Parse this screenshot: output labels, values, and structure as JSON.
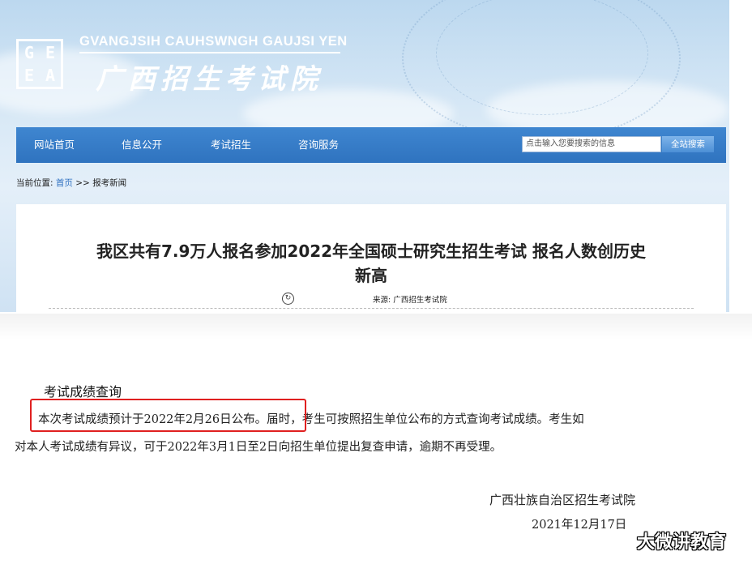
{
  "header": {
    "logo_letters": [
      "G",
      "E",
      "E",
      "A"
    ],
    "site_name_en": "GVANGJSIH CAUHSWNGH GAUJSI YEN",
    "site_name_cn": "广西招生考试院"
  },
  "nav": {
    "items": [
      {
        "label": "网站首页"
      },
      {
        "label": "信息公开"
      },
      {
        "label": "考试招生"
      },
      {
        "label": "咨询服务"
      }
    ],
    "search_placeholder": "点击输入您要搜索的信息",
    "search_button": "全站搜索"
  },
  "breadcrumb": {
    "prefix": "当前位置:",
    "home": "首页",
    "separator": ">>",
    "current": "报考新闻"
  },
  "article": {
    "title_line1": "我区共有7.9万人报名参加2022年全国硕士研究生招生考试 报名人数创历史",
    "title_line2": "新高",
    "source_label": "来源:",
    "source_value": "广西招生考试院"
  },
  "notice": {
    "heading": "考试成绩查询",
    "para1_highlighted": "本次考试成绩预计于2022年2月26日公布",
    "para1_rest": "。届时，考生可按照招生单位公布的方式查询考试成绩。考生如",
    "para2": "对本人考试成绩有异议，可于2022年3月1日至2日向招生单位提出复查申请，逾期不再受理。",
    "sign_org": "广西壮族自治区招生考试院",
    "sign_date": "2021年12月17日"
  },
  "watermark": "大微讲教育",
  "colors": {
    "nav_blue": "#3079c6",
    "highlight_red": "#e02020",
    "link_blue": "#2d6fc0"
  }
}
